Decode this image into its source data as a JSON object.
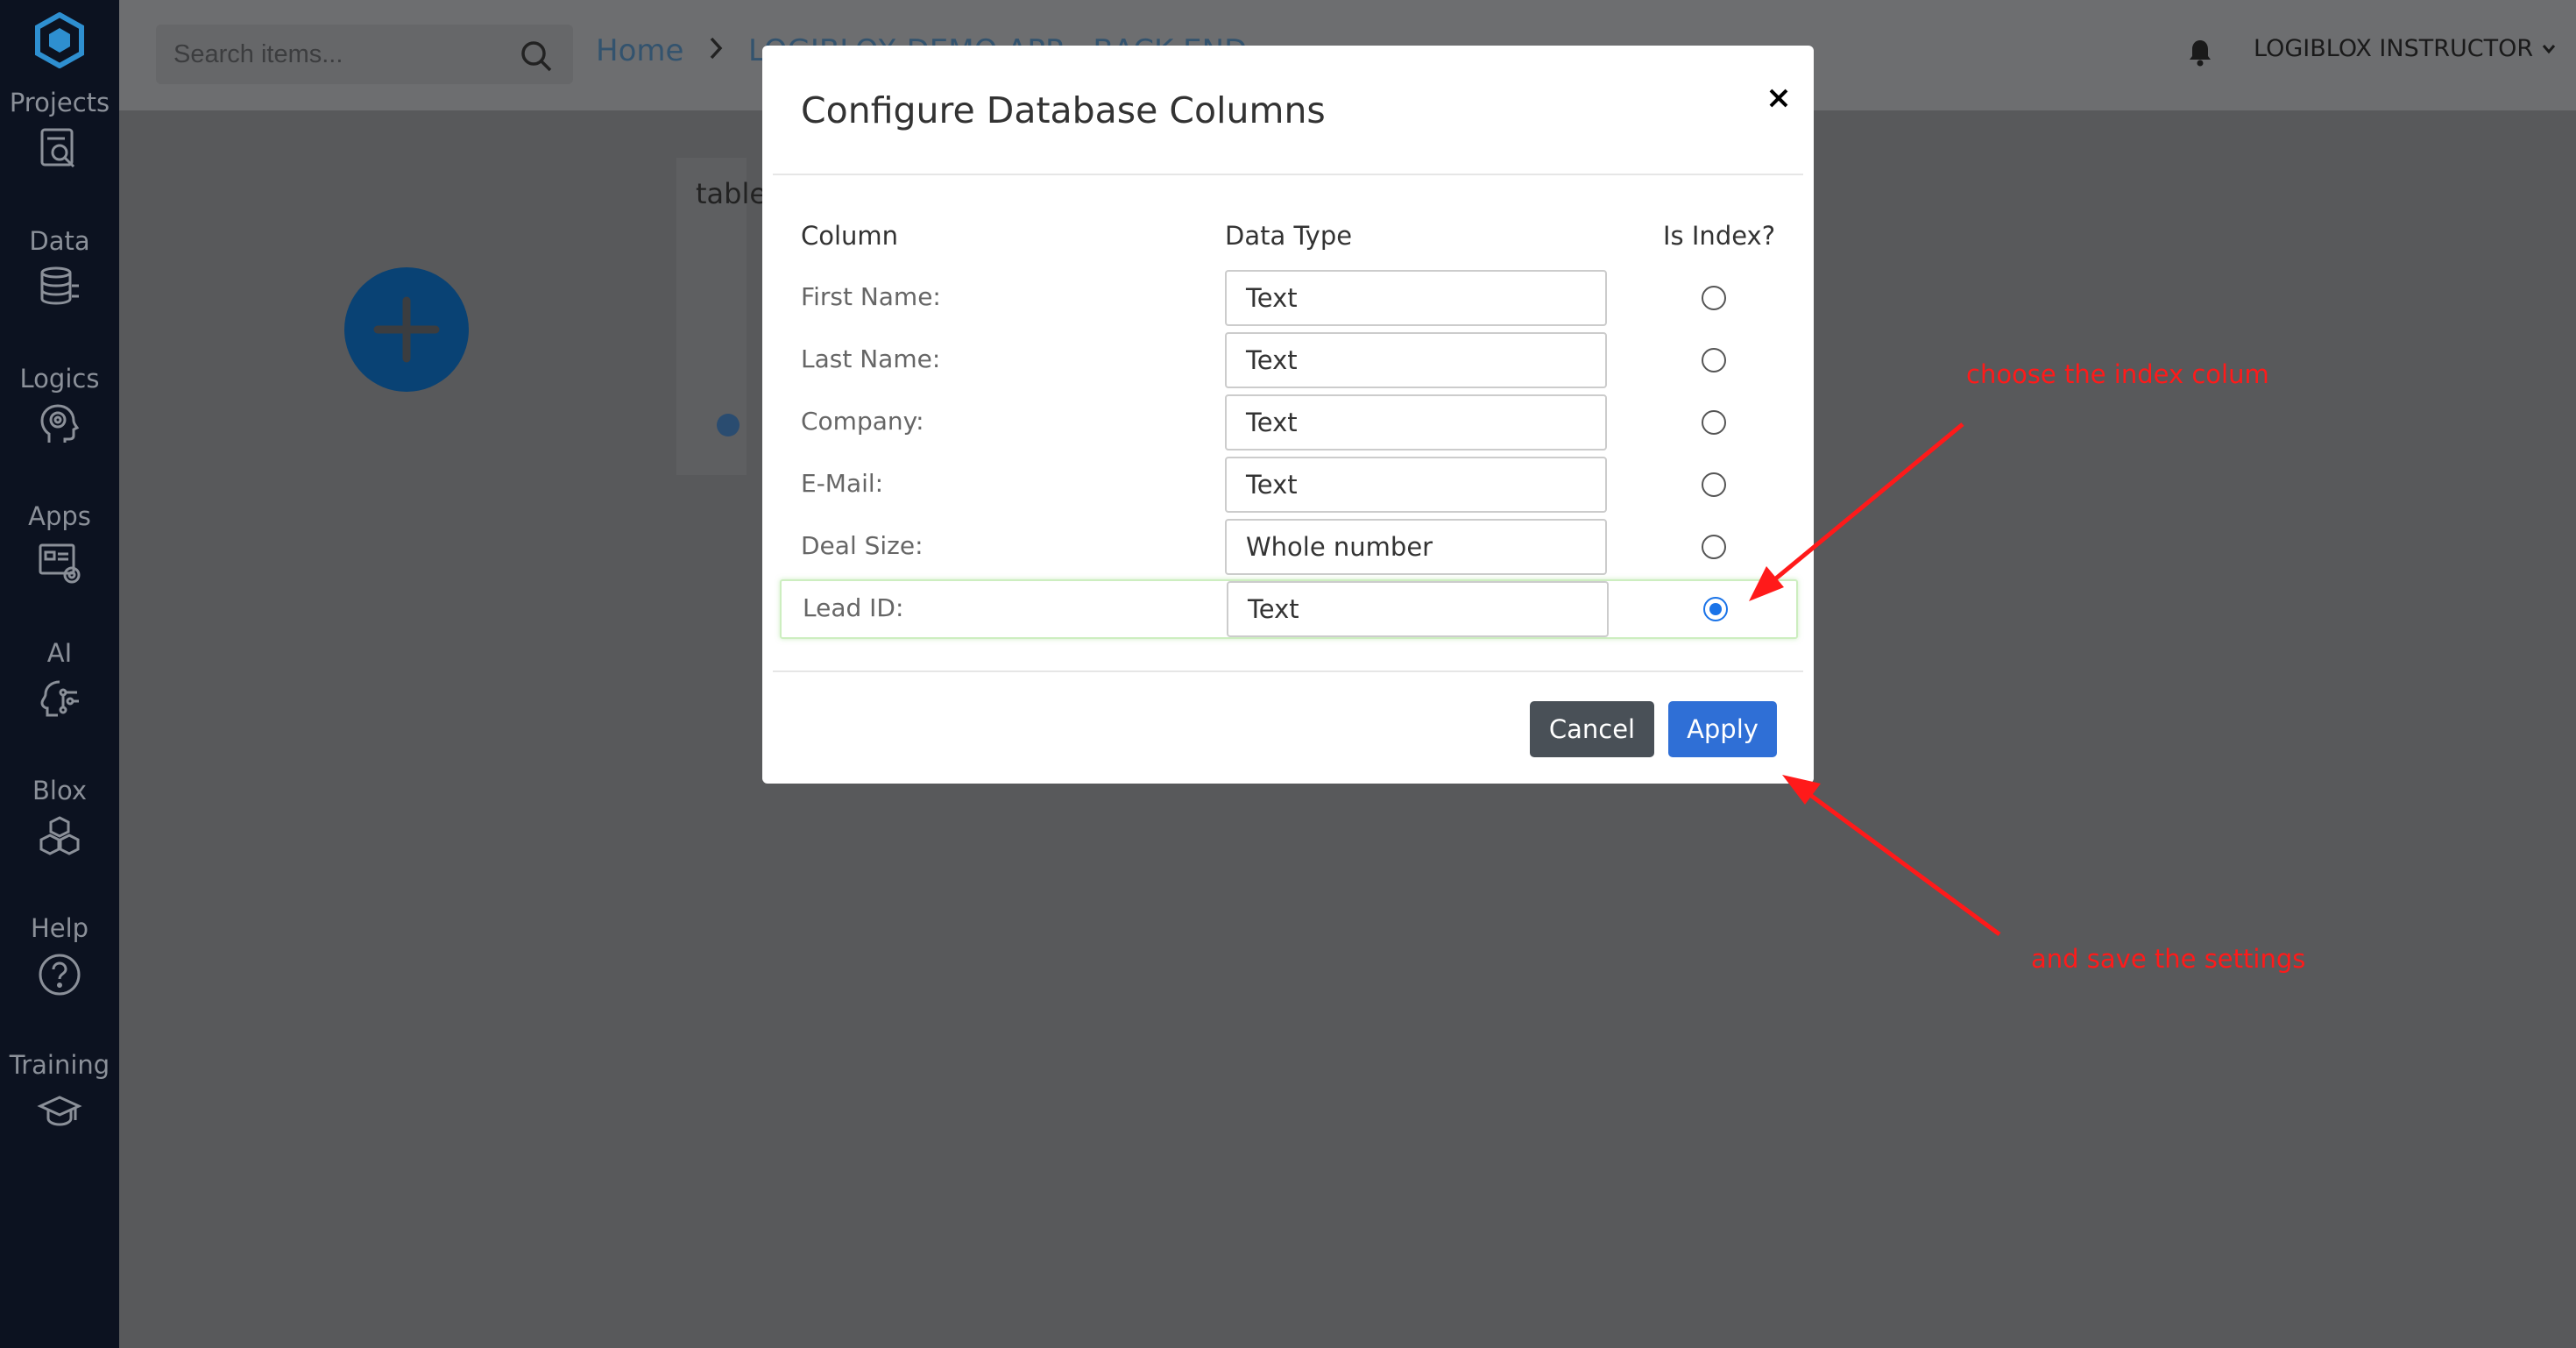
{
  "sidebar": {
    "items": [
      {
        "label": "Projects",
        "icon": "projects-icon"
      },
      {
        "label": "Data",
        "icon": "database-icon"
      },
      {
        "label": "Logics",
        "icon": "brain-icon"
      },
      {
        "label": "Apps",
        "icon": "apps-icon"
      },
      {
        "label": "AI",
        "icon": "ai-icon"
      },
      {
        "label": "Blox",
        "icon": "cubes-icon"
      },
      {
        "label": "Help",
        "icon": "help-icon"
      },
      {
        "label": "Training",
        "icon": "graduation-cap-icon"
      }
    ]
  },
  "header": {
    "search_placeholder": "Search items...",
    "breadcrumb_home": "Home",
    "breadcrumb_current": "LOGIBLOX DEMO APP - BACK END",
    "user_name": "LOGIBLOX INSTRUCTOR"
  },
  "background": {
    "card_title": "table"
  },
  "modal": {
    "title": "Configure Database Columns",
    "col_column": "Column",
    "col_type": "Data Type",
    "col_index": "Is Index?",
    "rows": [
      {
        "label": "First Name:",
        "type": "Text",
        "is_index": false
      },
      {
        "label": "Last Name:",
        "type": "Text",
        "is_index": false
      },
      {
        "label": "Company:",
        "type": "Text",
        "is_index": false
      },
      {
        "label": "E-Mail:",
        "type": "Text",
        "is_index": false
      },
      {
        "label": "Deal Size:",
        "type": "Whole number",
        "is_index": false
      },
      {
        "label": "Lead ID:",
        "type": "Text",
        "is_index": true
      }
    ],
    "cancel_label": "Cancel",
    "apply_label": "Apply"
  },
  "annotations": {
    "choose_index": "choose the index colum",
    "save_settings": "and save the settings"
  },
  "colors": {
    "sidebar_bg": "#0c1220",
    "overlay_bg": "#58595b",
    "apply_blue": "#2f6fd6",
    "cancel_gray": "#495057",
    "annotation_red": "#ff1a1a"
  }
}
